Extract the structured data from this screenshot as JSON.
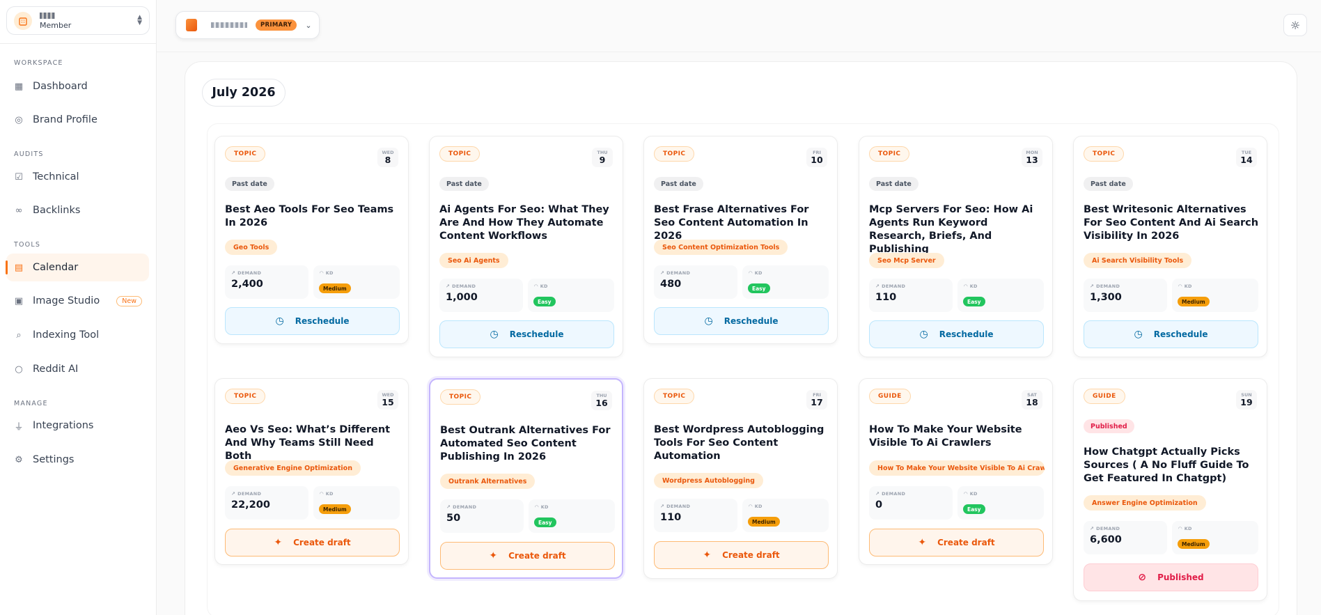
{
  "account": {
    "role": "Member"
  },
  "sidebar": {
    "sections": [
      {
        "label": "WORKSPACE",
        "items": [
          {
            "label": "Dashboard",
            "icon": "grid-icon"
          },
          {
            "label": "Brand Profile",
            "icon": "check-circle-icon"
          }
        ]
      },
      {
        "label": "AUDITS",
        "items": [
          {
            "label": "Technical",
            "icon": "clipboard-check-icon"
          },
          {
            "label": "Backlinks",
            "icon": "link-icon"
          }
        ]
      },
      {
        "label": "TOOLS",
        "items": [
          {
            "label": "Calendar",
            "icon": "calendar-icon",
            "active": true
          },
          {
            "label": "Image Studio",
            "icon": "image-icon",
            "badge": "New"
          },
          {
            "label": "Indexing Tool",
            "icon": "search-icon"
          },
          {
            "label": "Reddit AI",
            "icon": "chat-icon"
          }
        ]
      },
      {
        "label": "MANAGE",
        "items": [
          {
            "label": "Integrations",
            "icon": "plug-icon"
          },
          {
            "label": "Settings",
            "icon": "gear-icon"
          }
        ]
      }
    ]
  },
  "topbar": {
    "brand_badge": "PRIMARY"
  },
  "calendar": {
    "month": "July 2026",
    "labels": {
      "demand": "DEMAND",
      "kd": "KD"
    },
    "cards": [
      {
        "type": "TOPIC",
        "dow": "WED",
        "day": "8",
        "status": "Past date",
        "title": "Best Aeo Tools For Seo Teams In 2026",
        "tag": "Geo Tools",
        "demand": "2,400",
        "kd": "Medium",
        "action": "Reschedule"
      },
      {
        "type": "TOPIC",
        "dow": "THU",
        "day": "9",
        "status": "Past date",
        "title": "Ai Agents For Seo: What They Are And How They Automate Content Workflows",
        "tag": "Seo Ai Agents",
        "demand": "1,000",
        "kd": "Easy",
        "action": "Reschedule"
      },
      {
        "type": "TOPIC",
        "dow": "FRI",
        "day": "10",
        "status": "Past date",
        "title": "Best Frase Alternatives For Seo Content Automation In 2026",
        "tag": "Seo Content Optimization Tools",
        "demand": "480",
        "kd": "Easy",
        "action": "Reschedule"
      },
      {
        "type": "TOPIC",
        "dow": "MON",
        "day": "13",
        "status": "Past date",
        "title": "Mcp Servers For Seo: How Ai Agents Run Keyword Research, Briefs, And Publishing",
        "tag": "Seo Mcp Server",
        "demand": "110",
        "kd": "Easy",
        "action": "Reschedule"
      },
      {
        "type": "TOPIC",
        "dow": "TUE",
        "day": "14",
        "status": "Past date",
        "title": "Best Writesonic Alternatives For Seo Content And Ai Search Visibility In 2026",
        "tag": "Ai Search Visibility Tools",
        "demand": "1,300",
        "kd": "Medium",
        "action": "Reschedule"
      },
      {
        "type": "TOPIC",
        "dow": "WED",
        "day": "15",
        "status": "",
        "title": "Aeo Vs Seo: What’s Different And Why Teams Still Need Both",
        "tag": "Generative Engine Optimization",
        "demand": "22,200",
        "kd": "Medium",
        "action": "Create draft"
      },
      {
        "type": "TOPIC",
        "dow": "THU",
        "day": "16",
        "status": "",
        "title": "Best Outrank Alternatives For Automated Seo Content Publishing In 2026",
        "tag": "Outrank Alternatives",
        "demand": "50",
        "kd": "Easy",
        "action": "Create draft"
      },
      {
        "type": "TOPIC",
        "dow": "FRI",
        "day": "17",
        "status": "",
        "title": "Best Wordpress Autoblogging Tools For Seo Content Automation",
        "tag": "Wordpress Autoblogging",
        "demand": "110",
        "kd": "Medium",
        "action": "Create draft"
      },
      {
        "type": "GUIDE",
        "dow": "SAT",
        "day": "18",
        "status": "",
        "title": "How To Make Your Website Visible To Ai Crawlers",
        "tag": "How To Make Your Website Visible To Ai Crawle...",
        "demand": "0",
        "kd": "Easy",
        "action": "Create draft"
      },
      {
        "type": "GUIDE",
        "dow": "SUN",
        "day": "19",
        "status": "Published",
        "title": "How Chatgpt Actually Picks Sources ( A No Fluff Guide To Get Featured In Chatgpt)",
        "tag": "Answer Engine Optimization",
        "demand": "6,600",
        "kd": "Medium",
        "action": "Published"
      }
    ]
  }
}
